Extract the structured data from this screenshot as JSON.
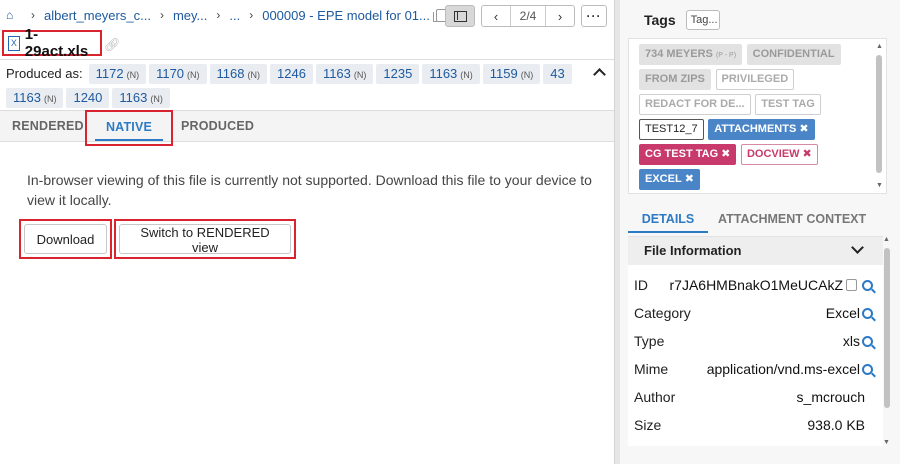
{
  "breadcrumb": {
    "items": [
      "albert_meyers_c...",
      "mey...",
      "...",
      "000009 - EPE model for 01..."
    ]
  },
  "pager": {
    "prev": "‹",
    "position": "2/4",
    "next": "›"
  },
  "more": "···",
  "file": {
    "name": "1-29act.xls",
    "icon_letter": "X"
  },
  "produced": {
    "label": "Produced as:",
    "items": [
      {
        "num": "1172",
        "suffix": "(N)"
      },
      {
        "num": "1170",
        "suffix": "(N)"
      },
      {
        "num": "1168",
        "suffix": "(N)"
      },
      {
        "num": "1246",
        "suffix": ""
      },
      {
        "num": "1163",
        "suffix": "(N)"
      },
      {
        "num": "1235",
        "suffix": ""
      },
      {
        "num": "1163",
        "suffix": "(N)"
      },
      {
        "num": "1159",
        "suffix": "(N)"
      },
      {
        "num": "43",
        "suffix": ""
      },
      {
        "num": "1163",
        "suffix": "(N)"
      },
      {
        "num": "1240",
        "suffix": ""
      },
      {
        "num": "1163",
        "suffix": "(N)"
      }
    ]
  },
  "tabs": {
    "rendered": "RENDERED",
    "native": "NATIVE",
    "produced": "PRODUCED"
  },
  "viewer": {
    "message": "In-browser viewing of this file is currently not supported. Download this file to your device to view it locally.",
    "download_label": "Download",
    "switch_label": "Switch to RENDERED view"
  },
  "tags": {
    "title": "Tags",
    "input_placeholder": "Tag...",
    "items": [
      {
        "text": "734 MEYERS",
        "small": "(P - P)",
        "style": "gray",
        "remove": false
      },
      {
        "text": "CONFIDENTIAL",
        "small": "",
        "style": "gray",
        "remove": false
      },
      {
        "text": "FROM ZIPS",
        "small": "",
        "style": "gray",
        "remove": false
      },
      {
        "text": "PRIVILEGED",
        "small": "",
        "style": "out",
        "remove": false
      },
      {
        "text": "REDACT FOR DE...",
        "small": "",
        "style": "out",
        "remove": false
      },
      {
        "text": "TEST TAG",
        "small": "",
        "style": "out",
        "remove": false
      },
      {
        "text": "TEST12_7",
        "small": "",
        "style": "dark",
        "remove": false
      },
      {
        "text": "ATTACHMENTS",
        "small": "",
        "style": "blue",
        "remove": true
      },
      {
        "text": "CG TEST TAG",
        "small": "",
        "style": "pink",
        "remove": true
      },
      {
        "text": "DOCVIEW",
        "small": "",
        "style": "pinkout",
        "remove": true
      },
      {
        "text": "EXCEL",
        "small": "",
        "style": "blue",
        "remove": true
      }
    ]
  },
  "details_tabs": {
    "details": "DETAILS",
    "attachment_context": "ATTACHMENT CONTEXT"
  },
  "file_info": {
    "title": "File Information",
    "rows": [
      {
        "key": "ID",
        "value": "r7JA6HMBnakO1MeUCAkZ",
        "copy": true,
        "search": true
      },
      {
        "key": "Category",
        "value": "Excel",
        "copy": false,
        "search": true
      },
      {
        "key": "Type",
        "value": "xls",
        "copy": false,
        "search": true
      },
      {
        "key": "Mime",
        "value": "application/vnd.ms-excel",
        "copy": false,
        "search": true
      },
      {
        "key": "Author",
        "value": "s_mcrouch",
        "copy": false,
        "search": false
      },
      {
        "key": "Size",
        "value": "938.0 KB",
        "copy": false,
        "search": false
      }
    ]
  },
  "colors": {
    "accent": "#2d7ac4",
    "highlight": "#d9232e",
    "link": "#1e5aa0"
  }
}
